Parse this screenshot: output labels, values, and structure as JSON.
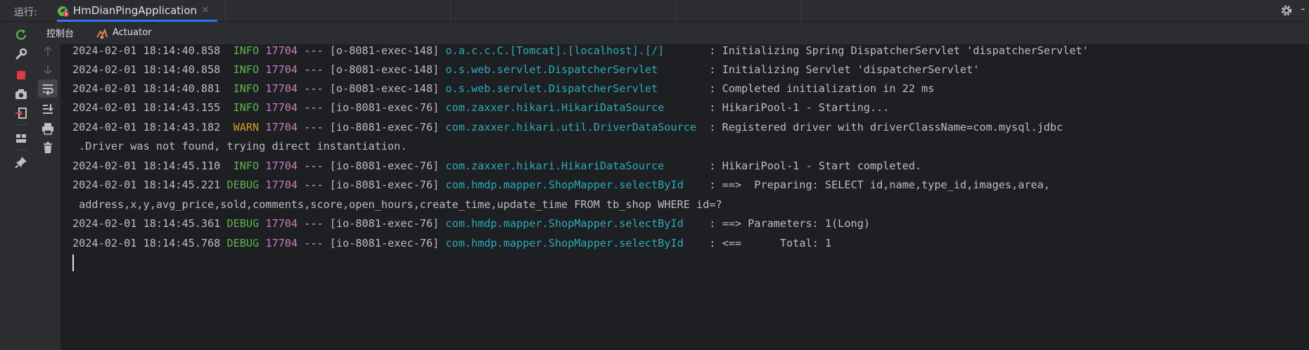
{
  "runbar": {
    "label": "运行:",
    "tab_name": "HmDianPingApplication",
    "close_glyph": "×",
    "minus_glyph": "-"
  },
  "subtabs": {
    "console": "控制台",
    "actuator": "Actuator"
  },
  "colors": {
    "info": "#5fb34f",
    "warn": "#cf9a2b",
    "pid": "#c77dbb",
    "logger": "#2aacb8",
    "accent": "#3574f0",
    "stop": "#db3b4b",
    "rerun": "#5fb34f"
  },
  "toolbar": {
    "left_icons": [
      "rerun-icon",
      "wrench-icon",
      "stop-icon",
      "camera-icon",
      "exit-icon",
      "layout-icon",
      "pin-icon"
    ],
    "console_icons": [
      "up-arrow-icon",
      "down-arrow-icon",
      "soft-wrap-icon",
      "scroll-to-end-icon",
      "print-icon",
      "trash-icon"
    ]
  },
  "log": [
    {
      "ts": "2024-02-01 18:14:40.858",
      "level": " INFO",
      "pid": "17704",
      "thread": "--- [o-8081-exec-148]",
      "logger": "o.a.c.c.C.[Tomcat].[localhost].[/]      ",
      "msg": " : Initializing Spring DispatcherServlet 'dispatcherServlet'"
    },
    {
      "ts": "2024-02-01 18:14:40.858",
      "level": " INFO",
      "pid": "17704",
      "thread": "--- [o-8081-exec-148]",
      "logger": "o.s.web.servlet.DispatcherServlet       ",
      "msg": " : Initializing Servlet 'dispatcherServlet'"
    },
    {
      "ts": "2024-02-01 18:14:40.881",
      "level": " INFO",
      "pid": "17704",
      "thread": "--- [o-8081-exec-148]",
      "logger": "o.s.web.servlet.DispatcherServlet       ",
      "msg": " : Completed initialization in 22 ms"
    },
    {
      "ts": "2024-02-01 18:14:43.155",
      "level": " INFO",
      "pid": "17704",
      "thread": "--- [io-8081-exec-76]",
      "logger": "com.zaxxer.hikari.HikariDataSource      ",
      "msg": " : HikariPool-1 - Starting..."
    },
    {
      "ts": "2024-02-01 18:14:43.182",
      "level": " WARN",
      "pid": "17704",
      "thread": "--- [io-8081-exec-76]",
      "logger": "com.zaxxer.hikari.util.DriverDataSource ",
      "msg": " : Registered driver with driverClassName=com.mysql.jdbc"
    },
    {
      "cont": " .Driver was not found, trying direct instantiation."
    },
    {
      "ts": "2024-02-01 18:14:45.110",
      "level": " INFO",
      "pid": "17704",
      "thread": "--- [io-8081-exec-76]",
      "logger": "com.zaxxer.hikari.HikariDataSource      ",
      "msg": " : HikariPool-1 - Start completed."
    },
    {
      "ts": "2024-02-01 18:14:45.221",
      "level": "DEBUG",
      "pid": "17704",
      "thread": "--- [io-8081-exec-76]",
      "logger": "com.hmdp.mapper.ShopMapper.selectById   ",
      "msg": " : ==>  Preparing: SELECT id,name,type_id,images,area,"
    },
    {
      "cont": " address,x,y,avg_price,sold,comments,score,open_hours,create_time,update_time FROM tb_shop WHERE id=?"
    },
    {
      "ts": "2024-02-01 18:14:45.361",
      "level": "DEBUG",
      "pid": "17704",
      "thread": "--- [io-8081-exec-76]",
      "logger": "com.hmdp.mapper.ShopMapper.selectById   ",
      "msg": " : ==> Parameters: 1(Long)"
    },
    {
      "ts": "2024-02-01 18:14:45.768",
      "level": "DEBUG",
      "pid": "17704",
      "thread": "--- [io-8081-exec-76]",
      "logger": "com.hmdp.mapper.ShopMapper.selectById   ",
      "msg": " : <==      Total: 1"
    }
  ]
}
